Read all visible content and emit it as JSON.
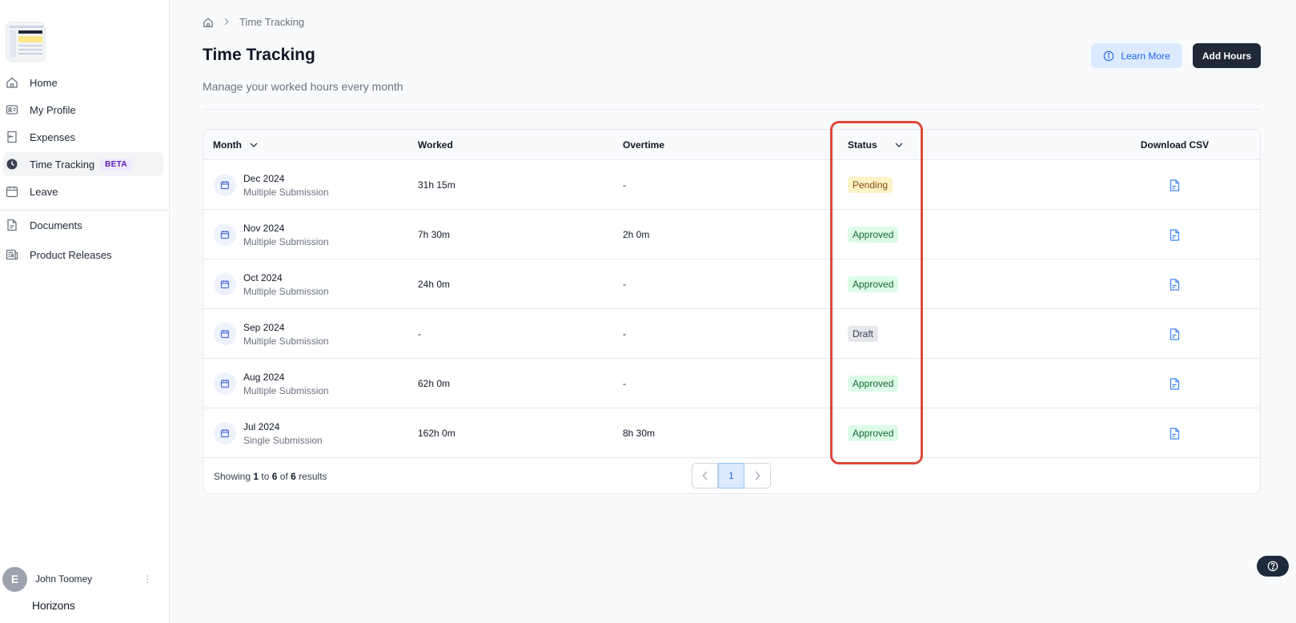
{
  "sidebar": {
    "items": [
      {
        "label": "Home",
        "icon": "home-icon"
      },
      {
        "label": "My Profile",
        "icon": "profile-card-icon"
      },
      {
        "label": "Expenses",
        "icon": "receipt-icon"
      },
      {
        "label": "Time Tracking",
        "icon": "clock-icon",
        "badge": "BETA",
        "active": true
      },
      {
        "label": "Leave",
        "icon": "calendar-icon"
      },
      {
        "label": "Documents",
        "icon": "document-icon"
      },
      {
        "label": "Product Releases",
        "icon": "newspaper-icon"
      }
    ],
    "user": {
      "initial": "E",
      "name": "John Toomey"
    },
    "brand": "Horizons"
  },
  "breadcrumb": {
    "current": "Time Tracking"
  },
  "page": {
    "title": "Time Tracking",
    "subtitle": "Manage your worked hours every month",
    "learn_more_label": "Learn More",
    "add_hours_label": "Add Hours"
  },
  "table": {
    "headers": {
      "month": "Month",
      "worked": "Worked",
      "overtime": "Overtime",
      "status": "Status",
      "download": "Download CSV"
    },
    "rows": [
      {
        "month": "Dec 2024",
        "submission": "Multiple Submission",
        "worked": "31h 15m",
        "overtime": "-",
        "status": "Pending",
        "status_type": "pending"
      },
      {
        "month": "Nov 2024",
        "submission": "Multiple Submission",
        "worked": "7h 30m",
        "overtime": "2h 0m",
        "status": "Approved",
        "status_type": "approved"
      },
      {
        "month": "Oct 2024",
        "submission": "Multiple Submission",
        "worked": "24h 0m",
        "overtime": "-",
        "status": "Approved",
        "status_type": "approved"
      },
      {
        "month": "Sep 2024",
        "submission": "Multiple Submission",
        "worked": "-",
        "overtime": "-",
        "status": "Draft",
        "status_type": "draft"
      },
      {
        "month": "Aug 2024",
        "submission": "Multiple Submission",
        "worked": "62h 0m",
        "overtime": "-",
        "status": "Approved",
        "status_type": "approved"
      },
      {
        "month": "Jul 2024",
        "submission": "Single Submission",
        "worked": "162h 0m",
        "overtime": "8h 30m",
        "status": "Approved",
        "status_type": "approved"
      }
    ]
  },
  "pagination": {
    "showing_prefix": "Showing",
    "from": "1",
    "to_word": "to",
    "to": "6",
    "of_word": "of",
    "total": "6",
    "suffix": "results",
    "current_page": "1"
  },
  "colors": {
    "accent": "#2563eb",
    "highlight": "#dc4a3a",
    "primary_button": "#1f2937"
  }
}
